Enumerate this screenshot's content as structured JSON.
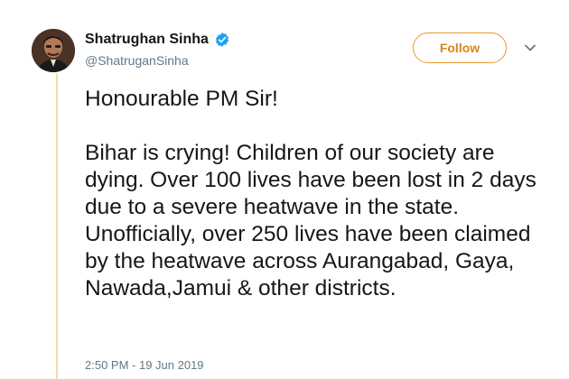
{
  "author": {
    "name": "Shatrughan Sinha",
    "handle": "@ShatruganSinha",
    "verified_icon": "verified-badge-icon",
    "avatar_icon": "user-avatar"
  },
  "actions": {
    "follow_label": "Follow",
    "menu_icon": "chevron-down-icon"
  },
  "tweet": {
    "text": "Honourable PM Sir!\n\nBihar is crying! Children of our society are dying. Over 100 lives have been lost in 2 days due to a severe heatwave in the state. Unofficially, over 250 lives have been claimed by the heatwave across Aurangabad, Gaya, Nawada,Jamui & other districts.",
    "timestamp": "2:50 PM - 19 Jun 2019"
  },
  "colors": {
    "accent": "#e69b2c",
    "verified": "#1da1f2",
    "thread_line": "#f5d9a8",
    "text": "#14171a",
    "muted": "#657786"
  }
}
